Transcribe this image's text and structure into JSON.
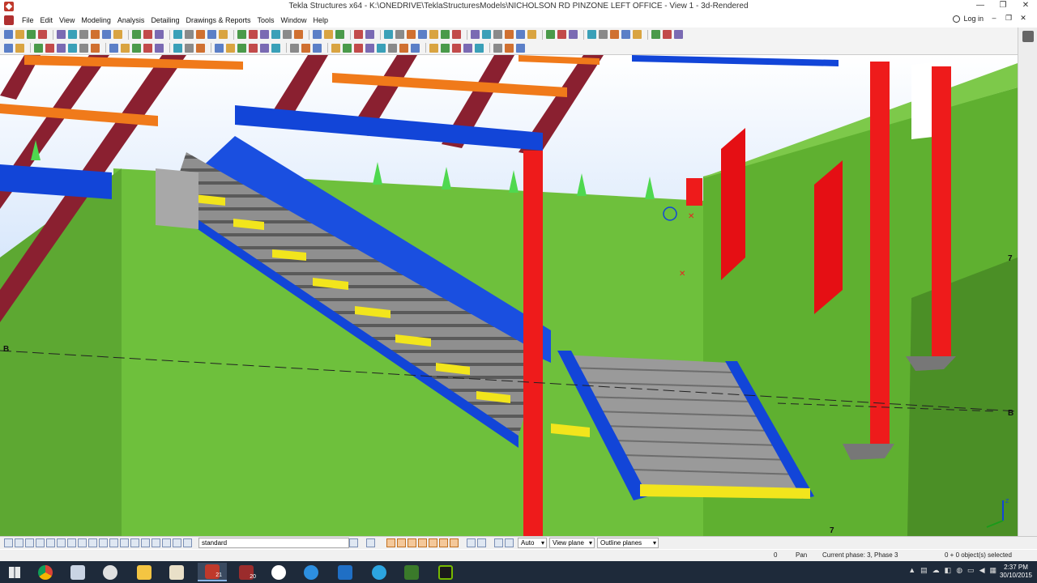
{
  "window": {
    "title": "Tekla Structures x64 - K:\\ONEDRIVE\\TeklaStructuresModels\\NICHOLSON RD PINZONE LEFT OFFICE  - View 1 - 3d-Rendered",
    "minimize": "—",
    "maximize": "❐",
    "close": "✕"
  },
  "menu": {
    "items": [
      "File",
      "Edit",
      "View",
      "Modeling",
      "Analysis",
      "Detailing",
      "Drawings & Reports",
      "Tools",
      "Window",
      "Help"
    ],
    "login_label": "Log in",
    "mdi_min": "–",
    "mdi_restore": "❐",
    "mdi_close": "✕"
  },
  "viewport": {
    "grid_label_b_left": "B",
    "grid_label_b_right": "B",
    "grid_label_7_top": "7",
    "grid_label_7_bottom": "7",
    "axes_x": "X",
    "axes_z": "Z"
  },
  "statusbar": {
    "filter_value": "standard",
    "snap_mode": "Auto",
    "plane_mode": "View plane",
    "outline_mode": "Outline planes"
  },
  "infobar": {
    "coord": "0",
    "mode": "Pan",
    "phase": "Current phase: 3, Phase 3",
    "selection": "0 + 0 object(s) selected"
  },
  "taskbar": {
    "time": "2:37 PM",
    "date": "30/10/2015",
    "badge_1": "21",
    "badge_2": "20"
  },
  "colors": {
    "wall_green": "#6bbd3a",
    "beam_blue": "#1245d8",
    "column_red": "#ec1b1b",
    "joist_maroon": "#8a2030",
    "purlin_orange": "#f07a1a",
    "tread_grey": "#8c8c8c",
    "tread_yellow": "#f2e51c"
  }
}
